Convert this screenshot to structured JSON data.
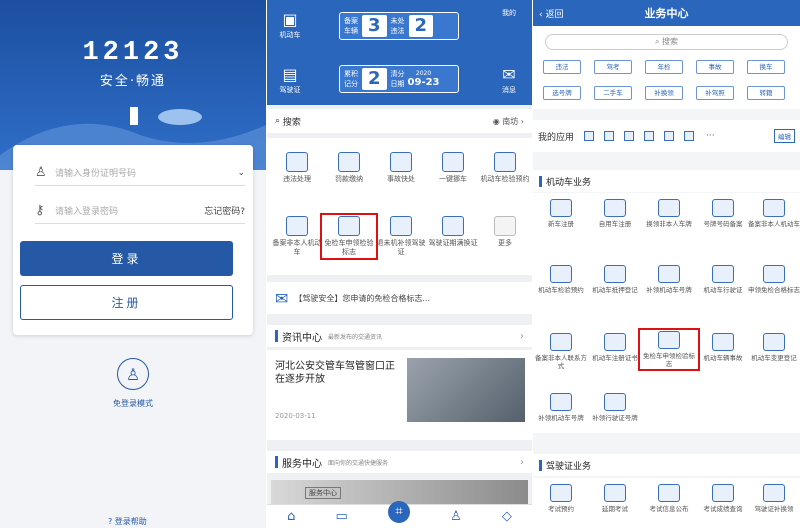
{
  "login": {
    "logo": "12123",
    "slogan": "安全·畅通",
    "id_placeholder": "请输入身份证明号码",
    "pw_placeholder": "请输入登录密码",
    "forgot": "忘记密码?",
    "login_btn": "登录",
    "register_btn": "注册",
    "guest": "免登录模式",
    "help": "登录帮助"
  },
  "home": {
    "plate1": {
      "label": "备案\n车辆",
      "count": "3",
      "label2": "未处\n违法",
      "count2": "2"
    },
    "plate2": {
      "label": "累积\n记分",
      "count": "2",
      "label2": "清分\n日期",
      "year": "2020",
      "date": "09-23"
    },
    "icons": {
      "vehicle": "机动车",
      "license": "驾驶证",
      "me": "我的",
      "msg": "消息"
    },
    "search": "搜索",
    "location": "南坊",
    "services": [
      "违法处理",
      "罚款缴纳",
      "事故快处",
      "一键挪车",
      "机动车检验预约",
      "备案非本人机动车",
      "免检车申领检验标志",
      "退未机补领驾驶证",
      "驾驶证期满换证",
      "更多"
    ],
    "notice": "【驾驶安全】您申请的免检合格标志...",
    "news_title": "资讯中心",
    "news_sub": "最新发布的交通资讯",
    "news_headline": "河北公安交管车驾管窗口正在逐步开放",
    "news_date": "2020-03-11",
    "service_title": "服务中心",
    "service_sub": "面向你的交通快捷服务",
    "service_img_label": "服务中心"
  },
  "center": {
    "back": "返回",
    "title": "业务中心",
    "search": "搜索",
    "tags": [
      "违法",
      "驾考",
      "年检",
      "事故",
      "换车",
      "选号牌",
      "二手车",
      "补换领",
      "补驾照",
      "转籍"
    ],
    "myapps": "我的应用",
    "more": "···",
    "grid_label": "编辑",
    "section1": "机动车业务",
    "items": [
      "新车注册",
      "自用车注册",
      "换领非本人车牌",
      "号牌号码备案",
      "备案非本人机动车",
      "机动车检验预约",
      "机动车抵押登记",
      "补领机动车号牌",
      "机动车行驶证",
      "申领免检合格标志",
      "备案非本人联系方式",
      "机动车注册证书",
      "免检车申领检验标志",
      "机动车辆事故",
      "机动车变更登记",
      "补领机动车号牌",
      "补领行驶证号牌"
    ],
    "section2": "驾驶证业务",
    "items2": [
      "考试预约",
      "延期考试",
      "考试信息公布",
      "考试成绩查询",
      "驾驶证补换领"
    ]
  }
}
